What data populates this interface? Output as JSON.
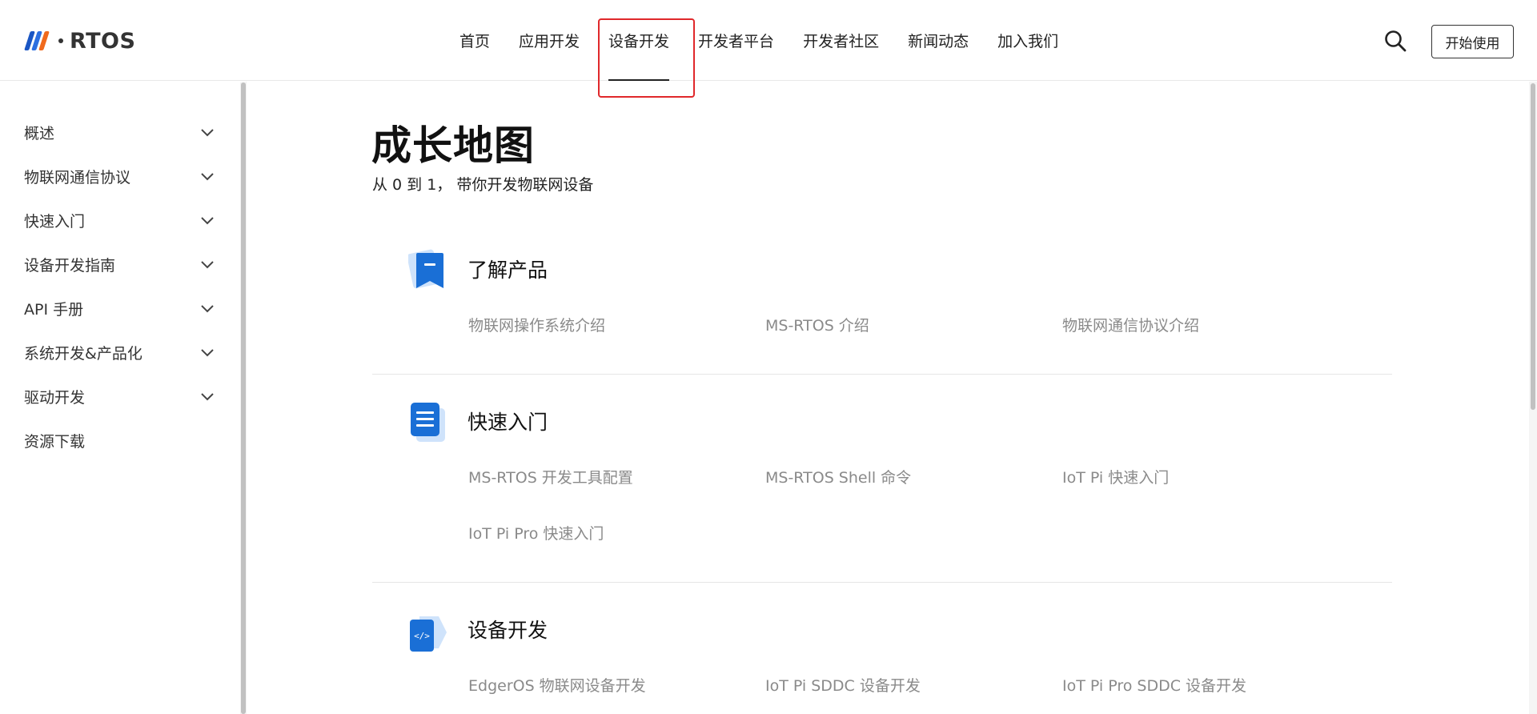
{
  "logo": {
    "text": "RTOS"
  },
  "nav": {
    "items": [
      {
        "label": "首页"
      },
      {
        "label": "应用开发"
      },
      {
        "label": "设备开发"
      },
      {
        "label": "开发者平台"
      },
      {
        "label": "开发者社区"
      },
      {
        "label": "新闻动态"
      },
      {
        "label": "加入我们"
      }
    ],
    "active_index": 2
  },
  "header": {
    "start_label": "开始使用"
  },
  "sidebar": {
    "items": [
      {
        "label": "概述",
        "expandable": true
      },
      {
        "label": "物联网通信协议",
        "expandable": true
      },
      {
        "label": "快速入门",
        "expandable": true
      },
      {
        "label": "设备开发指南",
        "expandable": true
      },
      {
        "label": "API 手册",
        "expandable": true
      },
      {
        "label": "系统开发&产品化",
        "expandable": true
      },
      {
        "label": "驱动开发",
        "expandable": true
      },
      {
        "label": "资源下载",
        "expandable": false
      }
    ]
  },
  "main": {
    "title": "成长地图",
    "subtitle": "从 0 到 1， 带你开发物联网设备",
    "sections": [
      {
        "title": "了解产品",
        "icon": "bookmark-icon",
        "links": [
          "物联网操作系统介绍",
          "MS-RTOS 介绍",
          "物联网通信协议介绍"
        ]
      },
      {
        "title": "快速入门",
        "icon": "document-icon",
        "links": [
          "MS-RTOS 开发工具配置",
          "MS-RTOS Shell 命令",
          "IoT Pi 快速入门",
          "IoT Pi Pro 快速入门"
        ]
      },
      {
        "title": "设备开发",
        "icon": "code-icon",
        "links": [
          "EdgerOS 物联网设备开发",
          "IoT Pi SDDC 设备开发",
          "IoT Pi Pro SDDC 设备开发"
        ]
      }
    ]
  },
  "colors": {
    "accent_blue": "#1a6fd6",
    "highlight_red": "#e0282b",
    "logo_orange": "#f06a1d"
  }
}
